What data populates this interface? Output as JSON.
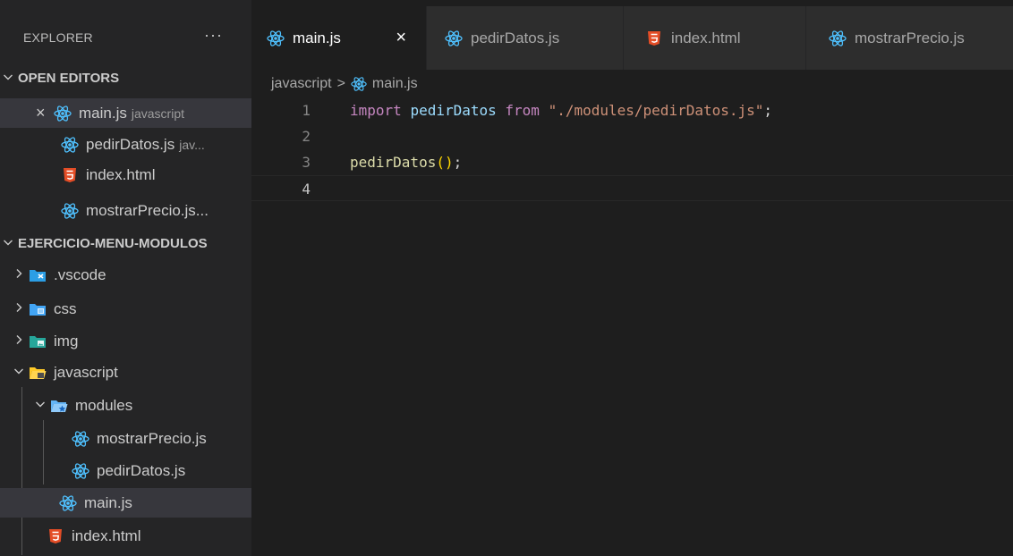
{
  "colors": {
    "react_icon": "#4fc1ff",
    "html_icon": "#e44d26",
    "sidebar_bg": "#252526",
    "editor_bg": "#1e1e1e",
    "selected_row": "#37373d"
  },
  "explorer": {
    "title": "EXPLORER",
    "more": "···",
    "open_editors": {
      "title": "OPEN EDITORS",
      "items": [
        {
          "label": "main.js",
          "hint": "javascript",
          "icon": "react-icon",
          "close": "×"
        },
        {
          "label": "pedirDatos.js",
          "hint": "jav...",
          "icon": "react-icon"
        },
        {
          "label": "index.html",
          "icon": "html5-icon"
        },
        {
          "label": "mostrarPrecio.js...",
          "icon": "react-icon"
        }
      ]
    },
    "project": {
      "title": "EJERCICIO-MENU-MODULOS",
      "items": [
        {
          "label": ".vscode",
          "icon": "vscode-folder-icon"
        },
        {
          "label": "css",
          "icon": "css-folder-icon"
        },
        {
          "label": "img",
          "icon": "images-folder-icon"
        },
        {
          "label": "javascript",
          "icon": "js-folder-open-icon"
        },
        {
          "label": "modules",
          "icon": "modules-folder-open-icon"
        },
        {
          "label": "mostrarPrecio.js",
          "icon": "react-icon"
        },
        {
          "label": "pedirDatos.js",
          "icon": "react-icon"
        },
        {
          "label": "main.js",
          "icon": "react-icon"
        },
        {
          "label": "index.html",
          "icon": "html5-icon"
        }
      ]
    }
  },
  "tabs": [
    {
      "label": "main.js",
      "icon": "react-icon",
      "active": true,
      "close": "×"
    },
    {
      "label": "pedirDatos.js",
      "icon": "react-icon"
    },
    {
      "label": "index.html",
      "icon": "html5-icon"
    },
    {
      "label": "mostrarPrecio.js",
      "icon": "react-icon"
    }
  ],
  "breadcrumb": {
    "folder": "javascript",
    "sep": ">",
    "file": "main.js"
  },
  "editor": {
    "lines": [
      {
        "number": "1",
        "tokens": [
          {
            "t": "import",
            "c": "kw"
          },
          {
            "t": " ",
            "c": "tx"
          },
          {
            "t": "pedirDatos",
            "c": "id"
          },
          {
            "t": " ",
            "c": "tx"
          },
          {
            "t": "from",
            "c": "kw"
          },
          {
            "t": " ",
            "c": "tx"
          },
          {
            "t": "\"./modules/pedirDatos.js\"",
            "c": "str"
          },
          {
            "t": ";",
            "c": "tx"
          }
        ]
      },
      {
        "number": "2",
        "tokens": []
      },
      {
        "number": "3",
        "tokens": [
          {
            "t": "pedirDatos",
            "c": "fn"
          },
          {
            "t": "()",
            "c": "pn"
          },
          {
            "t": ";",
            "c": "tx"
          }
        ]
      },
      {
        "number": "4",
        "tokens": [],
        "current": true
      }
    ]
  }
}
